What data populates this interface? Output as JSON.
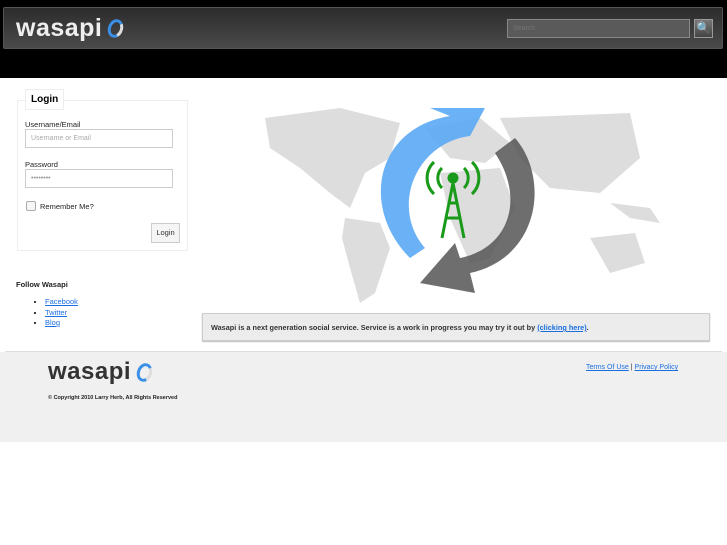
{
  "header": {
    "logo": "wasapi",
    "search_placeholder": "Search",
    "search_icon": "magnifier-icon"
  },
  "login": {
    "title": "Login",
    "username_label": "Username/Email",
    "username_placeholder": "Username or Email",
    "password_label": "Password",
    "password_value": "••••••••",
    "remember_label": "Remember Me?",
    "button": "Login"
  },
  "follow": {
    "title": "Follow Wasapi",
    "links": [
      "Facebook",
      "Twitter",
      "Blog"
    ]
  },
  "notice": {
    "text": "Wasapi is a next generation social service. Service is a work in progress you may try it out by ",
    "link": "(clicking here)",
    "end": "."
  },
  "footer": {
    "logo": "wasapi",
    "copyright": "© Copyright 2010 Larry Herb, All Rights Reserved",
    "terms": "Terms Of Use",
    "sep": "|",
    "privacy": "Privacy Policy"
  }
}
